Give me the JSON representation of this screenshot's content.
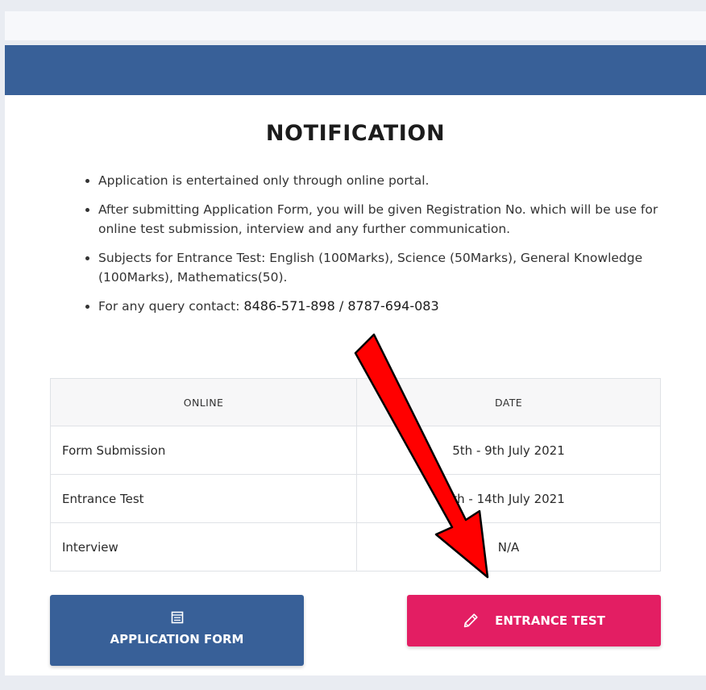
{
  "notification": {
    "title": "NOTIFICATION",
    "items": [
      "Application is entertained only through online portal.",
      "After submitting Application Form, you will be given Registration No. which will be use for online test submission, interview and any further communication.",
      "Subjects for Entrance Test: English (100Marks), Science (50Marks), General Knowledge (100Marks), Mathematics(50)."
    ],
    "contact_label": "For any query contact: ",
    "contact_numbers": "8486-571-898 / 8787-694-083"
  },
  "schedule": {
    "headers": [
      "ONLINE",
      "DATE"
    ],
    "rows": [
      {
        "event": "Form Submission",
        "date": "5th - 9th July 2021"
      },
      {
        "event": "Entrance Test",
        "date": "th - 14th July 2021"
      },
      {
        "event": "Interview",
        "date": "N/A"
      }
    ]
  },
  "buttons": {
    "application_form": "APPLICATION FORM",
    "application_icon": "form-icon",
    "entrance_test": "ENTRANCE TEST",
    "entrance_icon": "pencil-icon"
  },
  "colors": {
    "header_blue": "#386098",
    "entrance_pink": "#e31e63",
    "arrow_red": "#ff0000"
  }
}
